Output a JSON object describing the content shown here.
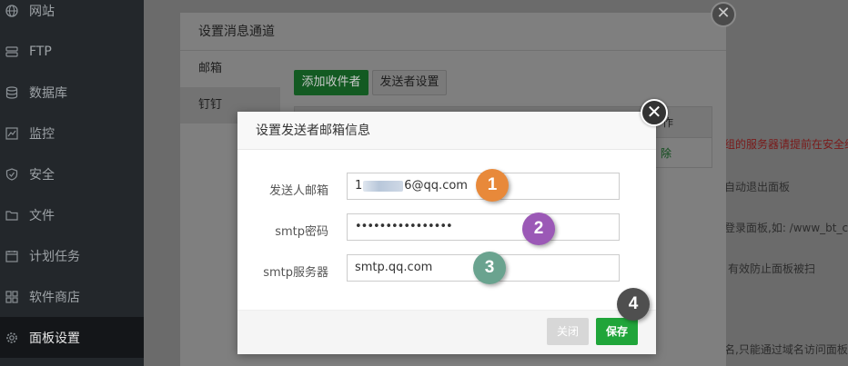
{
  "sidebar": {
    "items": [
      {
        "label": "网站",
        "icon": "globe-icon"
      },
      {
        "label": "FTP",
        "icon": "server-icon"
      },
      {
        "label": "数据库",
        "icon": "database-icon"
      },
      {
        "label": "监控",
        "icon": "monitor-icon"
      },
      {
        "label": "安全",
        "icon": "shield-icon"
      },
      {
        "label": "文件",
        "icon": "folder-icon"
      },
      {
        "label": "计划任务",
        "icon": "calendar-icon"
      },
      {
        "label": "软件商店",
        "icon": "apps-icon"
      },
      {
        "label": "面板设置",
        "icon": "gear-icon"
      }
    ]
  },
  "page": {
    "line1": "组的服务器请提前在安全组",
    "line2": "自动退出面板",
    "line3": "登录面板,如: /www_bt_cn",
    "line4": "有效防止面板被扫",
    "line5": "名,只能通过域名访问面板"
  },
  "outer_modal": {
    "title": "设置消息通道",
    "nav": [
      "邮箱",
      "钉钉"
    ],
    "add_recipient_label": "添加收件者",
    "sender_settings_label": "发送者设置",
    "table_header_right": "作",
    "table_delete_label": "除",
    "close_glyph": "✕"
  },
  "inner_modal": {
    "title": "设置发送者邮箱信息",
    "fields": [
      {
        "label": "发送人邮箱",
        "prefix": "1",
        "suffix": "6@qq.com"
      },
      {
        "label": "smtp密码",
        "value": "••••••••••••••••"
      },
      {
        "label": "smtp服务器",
        "value": "smtp.qq.com"
      }
    ],
    "close_button_label": "关闭",
    "save_button_label": "保存",
    "close_glyph": "✕"
  },
  "badges": [
    {
      "number": "1",
      "color": "#e8893a"
    },
    {
      "number": "2",
      "color": "#9b59b6"
    },
    {
      "number": "3",
      "color": "#6aa38f"
    },
    {
      "number": "4",
      "color": "#4f4f4f"
    }
  ],
  "colors": {
    "primary_green": "#20a53a",
    "sidebar_bg": "#23272b"
  }
}
